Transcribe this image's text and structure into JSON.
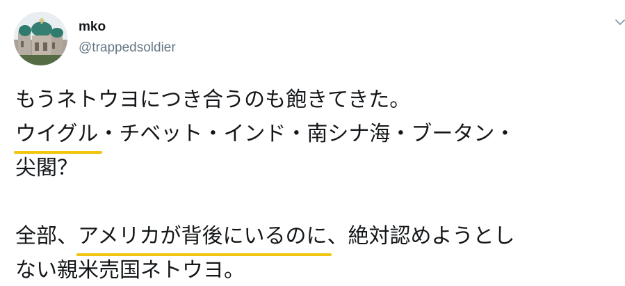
{
  "user": {
    "display_name": "mko",
    "handle": "@trappedsoldier"
  },
  "tweet": {
    "line1": "もうネトウヨにつき合うのも飽きてきた。",
    "line2_highlight": "ウイグル",
    "line2_rest": "・チベット・インド・南シナ海・ブータン・",
    "line3": "尖閣？",
    "line4_pre": "全部、",
    "line4_highlight": "アメリカが背後にいるのに",
    "line4_post": "、絶対認めようとし",
    "line5": "ない親米売国ネトウヨ。"
  },
  "colors": {
    "highlight_underline": "#f1c40f",
    "handle_text": "#657786",
    "body_text": "#14171a"
  },
  "icons": {
    "menu": "chevron-down-icon",
    "avatar": "church-domes-photo"
  }
}
